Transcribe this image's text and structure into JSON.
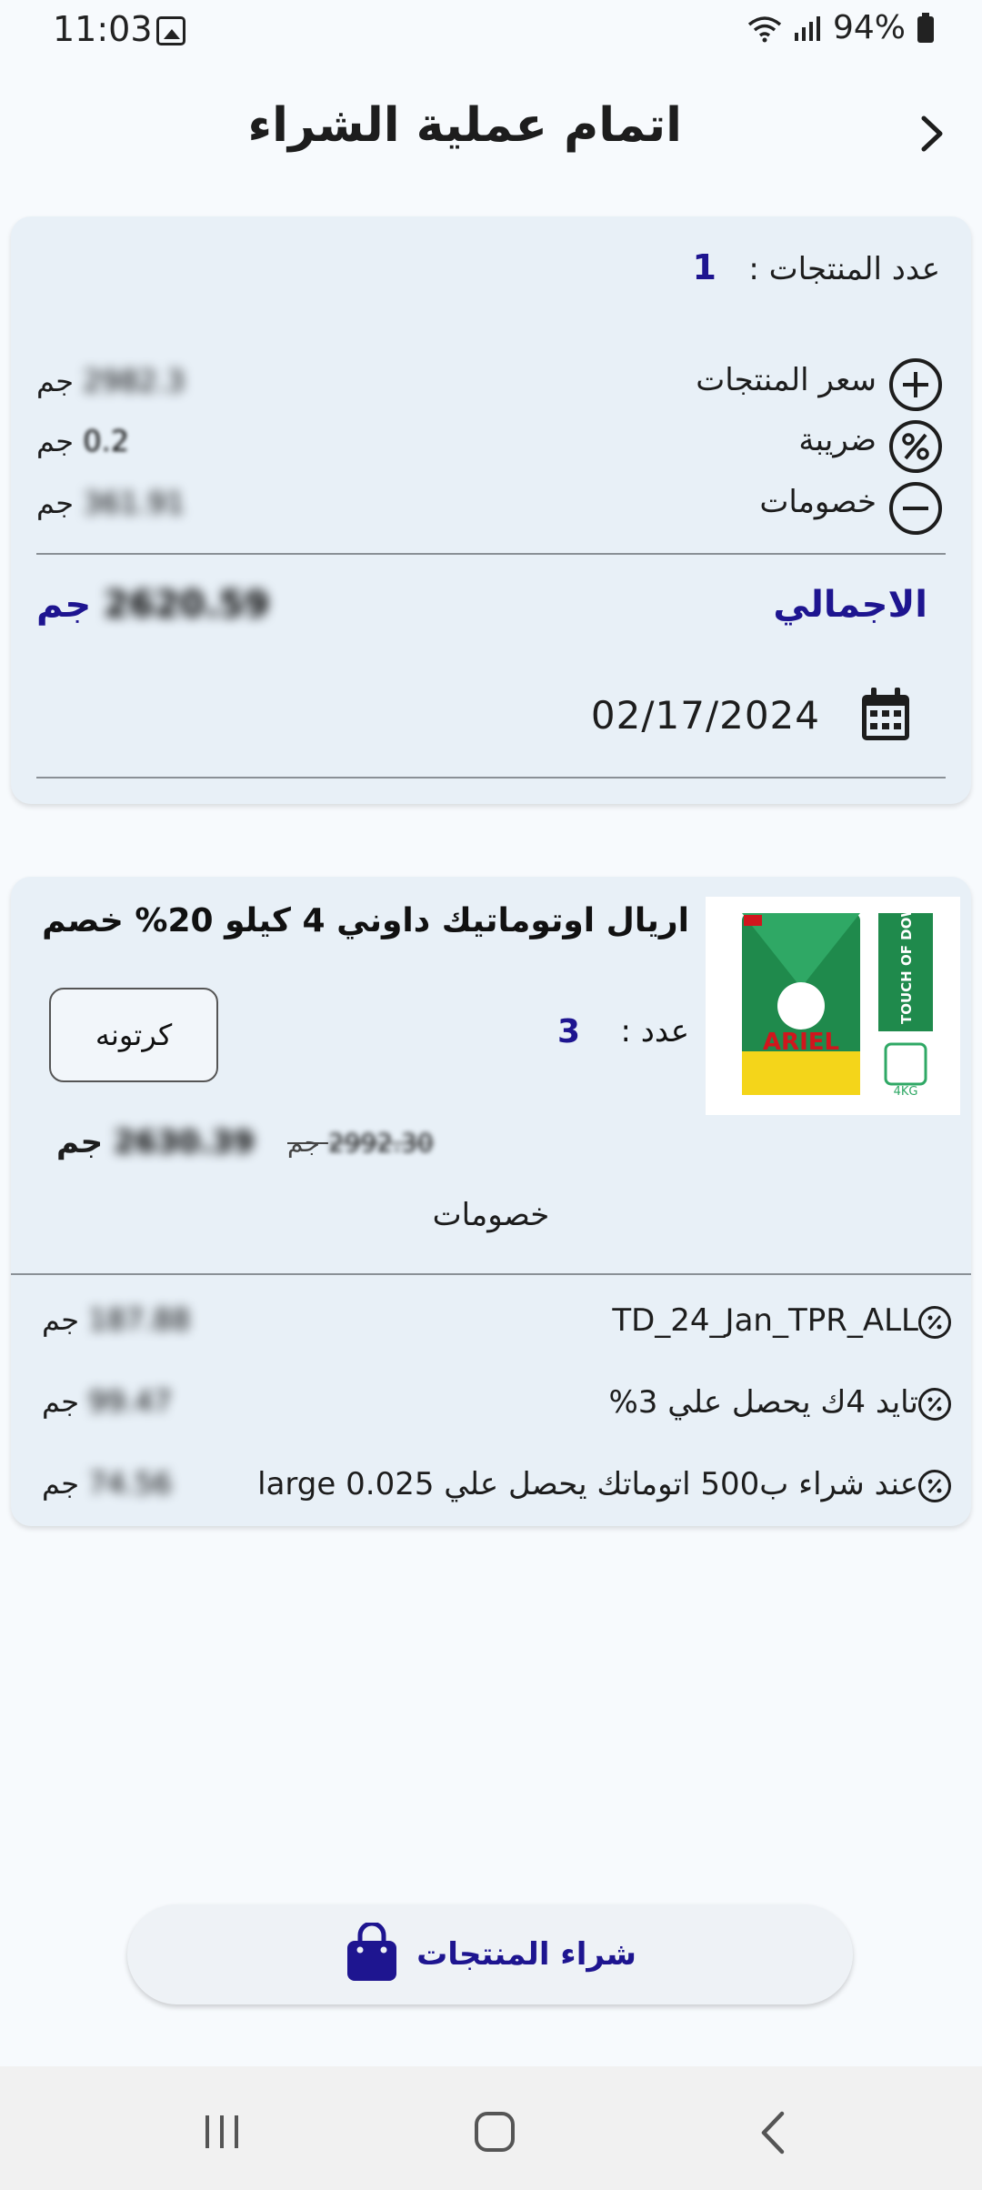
{
  "status_bar": {
    "time": "11:03",
    "battery": "94%"
  },
  "header": {
    "title": "اتمام عملية الشراء"
  },
  "summary": {
    "count_label": "عدد المنتجات :",
    "count_value": "1",
    "price_label": "سعر المنتجات",
    "price_amount": "2982.3",
    "tax_label": "ضريبة",
    "tax_amount": "0.2",
    "discounts_label": "خصومات",
    "discounts_amount": "361.91",
    "currency": "جم",
    "total_label": "الاجمالي",
    "total_amount": "2620.59",
    "date": "02/17/2024"
  },
  "product": {
    "name": "اريال اوتوماتيك داوني 4 كيلو 20% خصم",
    "qty_label": "عدد :",
    "qty_value": "3",
    "unit": "كرتونه",
    "price_after": "2630.39",
    "price_before": "2992.30",
    "currency": "جم",
    "image_brand": "ARIEL",
    "image_side_text": "TOUCH OF DOWNY",
    "image_weight": "4KG",
    "discounts_title": "خصومات",
    "discounts": [
      {
        "name": "TD_24_Jan_TPR_ALL",
        "amount": "187.88"
      },
      {
        "name": "تايد 4ك يحصل علي 3%",
        "amount": "99.47"
      },
      {
        "name": "عند شراء ب500 اتوماتك يحصل علي 0.025 large",
        "amount": "74.56"
      }
    ]
  },
  "buy_button": {
    "label": "شراء المنتجات"
  },
  "colors": {
    "accent": "#1e1590",
    "background": "#f7fafd",
    "card": "#e8f0f7"
  }
}
